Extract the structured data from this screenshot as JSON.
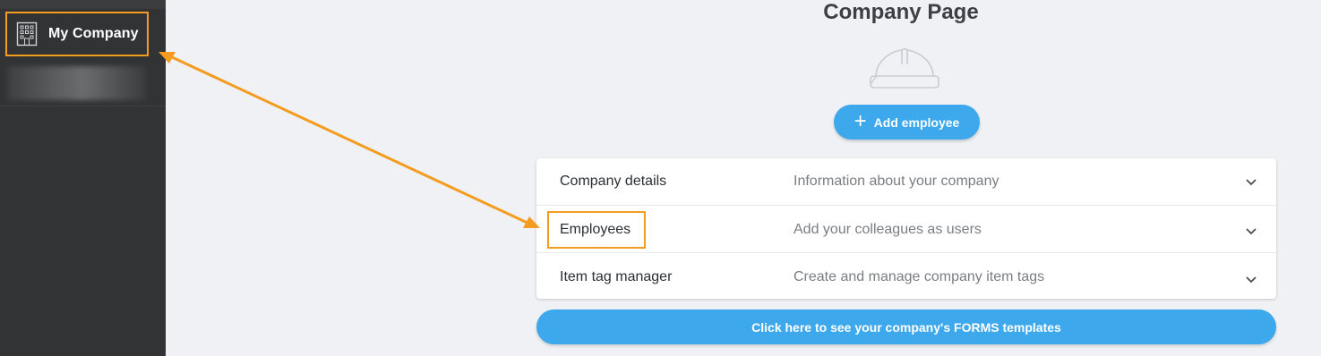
{
  "sidebar": {
    "active_item": {
      "label": "My Company",
      "icon": "building-icon"
    }
  },
  "main": {
    "title": "Company Page",
    "illustration": "hard-hat-icon",
    "add_employee_label": "Add employee",
    "sections": [
      {
        "title": "Company details",
        "description": "Information about your company"
      },
      {
        "title": "Employees",
        "description": "Add your colleagues as users"
      },
      {
        "title": "Item tag manager",
        "description": "Create and manage company item tags"
      }
    ],
    "forms_button_label": "Click here to see your company's FORMS templates"
  },
  "colors": {
    "accent_blue": "#3da8ec",
    "highlight_orange": "#f39c1f",
    "sidebar_bg": "#313335",
    "page_bg": "#eff1f4"
  }
}
